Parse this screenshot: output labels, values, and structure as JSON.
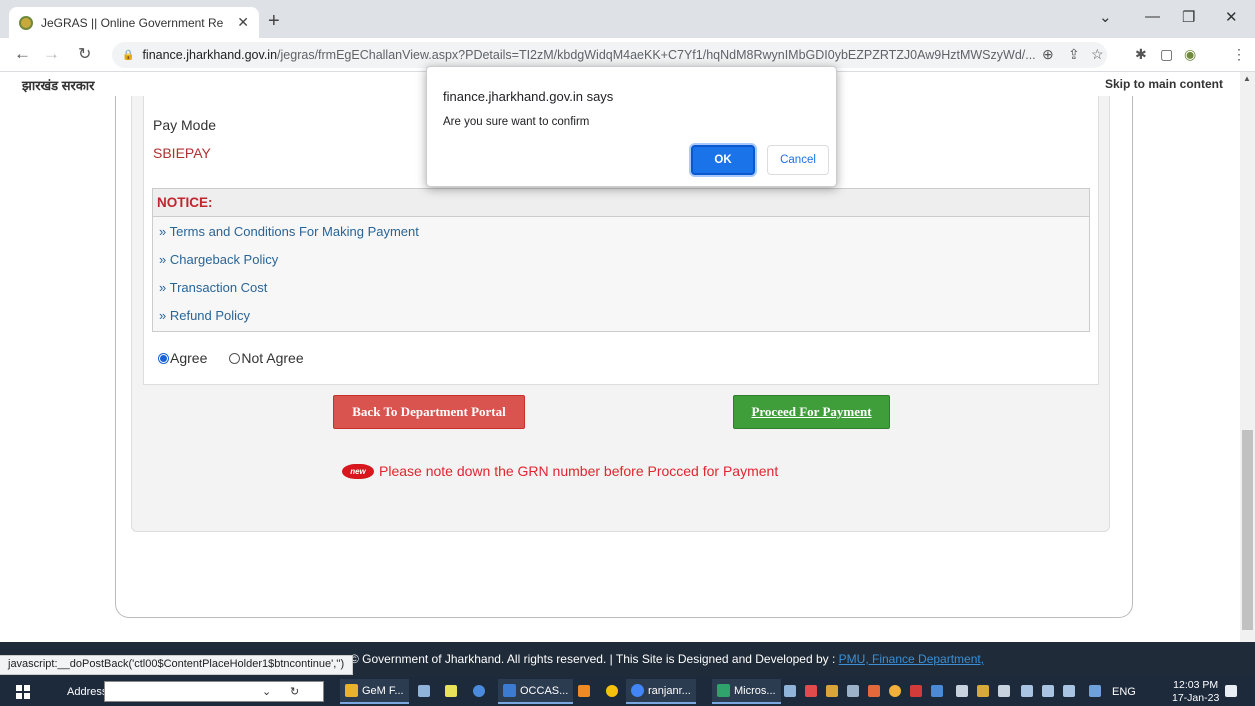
{
  "browser": {
    "tab_title": "JeGRAS || Online Government Re",
    "tab_close": "✕",
    "new_tab": "+",
    "url_host": "finance.jharkhand.gov.in",
    "url_path": "/jegras/frmEgEChallanView.aspx?PDetails=TI2zM/kbdgWidqM4aeKK+C7Yf1/hqNdM8RwynIMbGDI0ybEZPZRTZJ0Aw9HztMWSzyWd/..."
  },
  "header": {
    "gov_name": "झारखंड सरकार",
    "skip_link": "Skip to main content"
  },
  "payment": {
    "pay_mode_label": "Pay Mode",
    "pay_mode_value": "SBIEPAY"
  },
  "notice": {
    "title": "NOTICE:",
    "links": [
      "» Terms and Conditions For Making Payment",
      "» Chargeback Policy",
      "» Transaction Cost",
      "» Refund Policy"
    ]
  },
  "agreement": {
    "agree": "Agree",
    "not_agree": "Not Agree",
    "selected": "Agree"
  },
  "actions": {
    "back": "Back To Department Portal",
    "proceed": "Proceed For Payment"
  },
  "grn_note": {
    "badge": "new",
    "text": "Please note down the GRN number before Procced for Payment"
  },
  "footer": {
    "copyright": "© Government of Jharkhand. All rights reserved.   |   This Site is Designed and Developed by :",
    "developer": "PMU, Finance Department,"
  },
  "status_bar": "javascript:__doPostBack('ctl00$ContentPlaceHolder1$btncontinue','')",
  "dialog": {
    "title": "finance.jharkhand.gov.in says",
    "message": "Are you sure want to confirm",
    "ok": "OK",
    "cancel": "Cancel"
  },
  "taskbar": {
    "address_label": "Address",
    "apps": [
      "GeM F...",
      "OCCAS...",
      "ranjanr...",
      "Micros..."
    ],
    "language": "ENG",
    "time": "12:03 PM",
    "date": "17-Jan-23"
  }
}
